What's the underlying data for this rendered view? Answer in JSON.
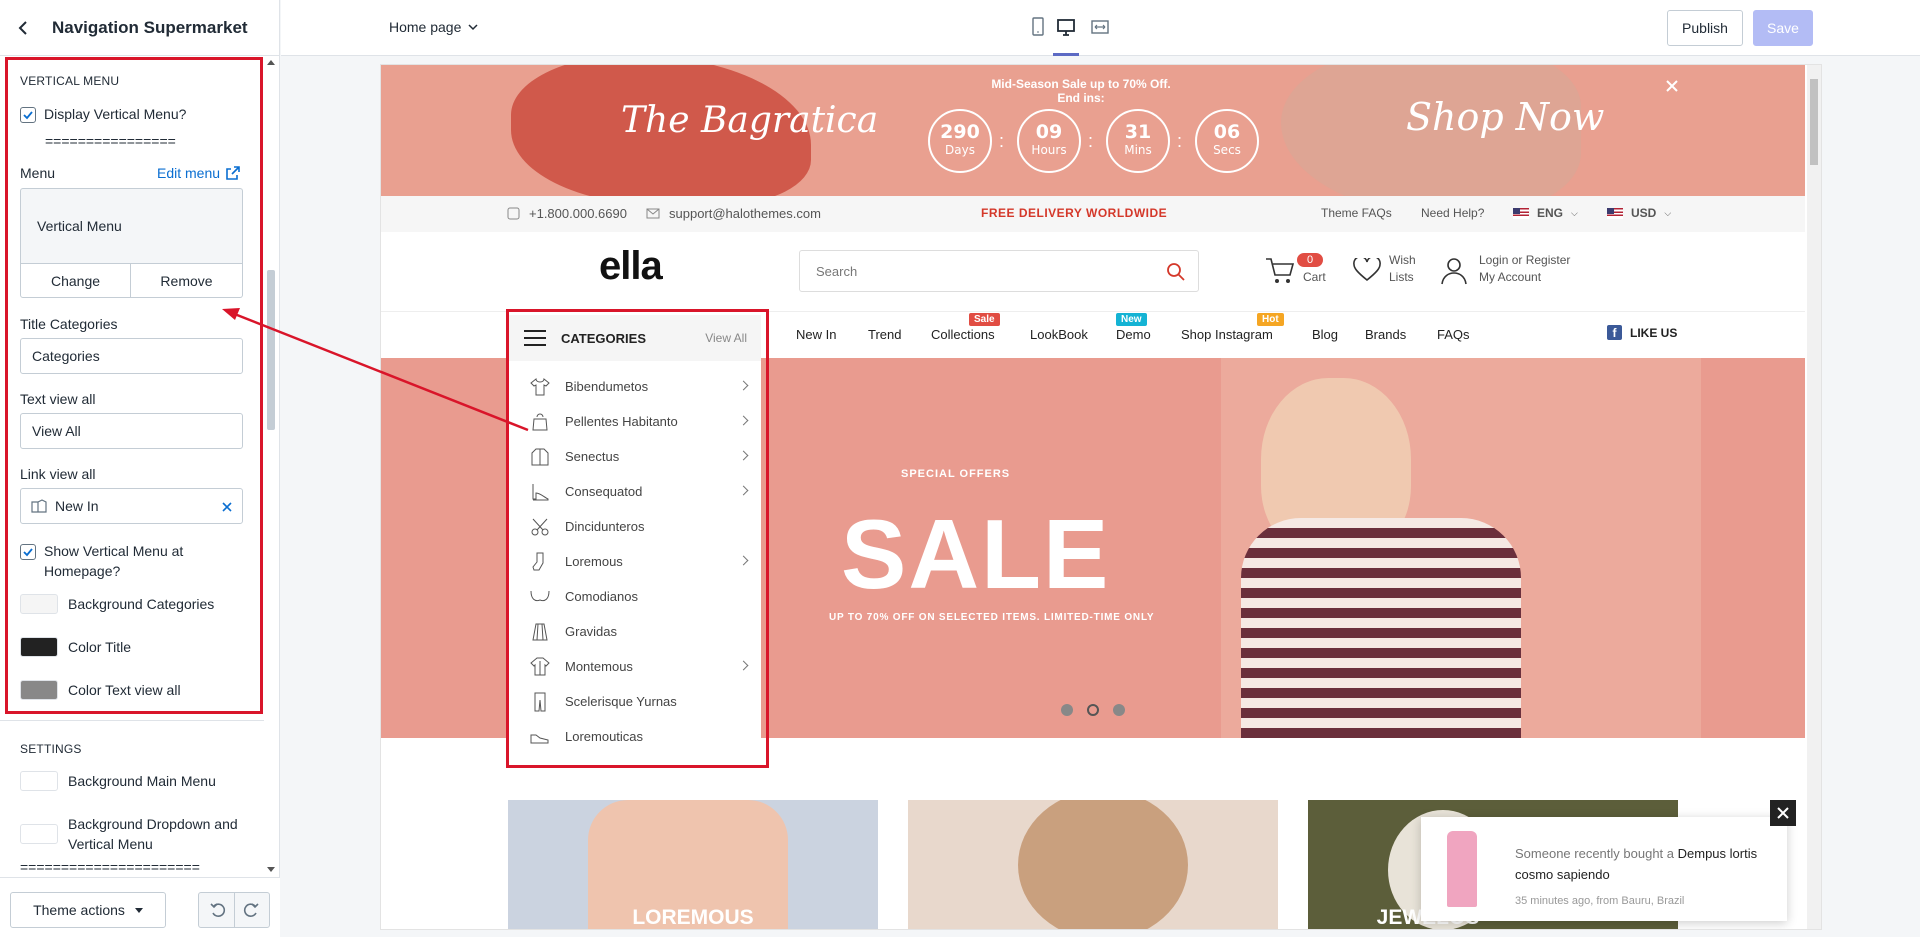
{
  "editor": {
    "title": "Navigation Supermarket",
    "page_select": "Home page",
    "publish_label": "Publish",
    "save_label": "Save",
    "theme_actions_label": "Theme actions"
  },
  "vertical_menu_settings": {
    "section_title": "VERTICAL MENU",
    "display_label": "Display Vertical Menu?",
    "divider": "================",
    "menu_label": "Menu",
    "edit_menu_label": "Edit menu",
    "menu_value": "Vertical Menu",
    "change_label": "Change",
    "remove_label": "Remove",
    "title_categories_label": "Title Categories",
    "title_categories_value": "Categories",
    "text_view_all_label": "Text view all",
    "text_view_all_value": "View All",
    "link_view_all_label": "Link view all",
    "link_view_all_value": "New In",
    "show_homepage_label": "Show Vertical Menu at Homepage?",
    "bg_categories_label": "Background Categories",
    "color_title_label": "Color Title",
    "color_text_view_all_label": "Color Text view all",
    "bg_categories_color": "#f5f5f5",
    "color_title_color": "#222222",
    "color_text_view_all_color": "#888888"
  },
  "settings": {
    "section_title": "SETTINGS",
    "bg_main_menu_label": "Background Main Menu",
    "bg_dropdown_label": "Background Dropdown and Vertical Menu",
    "divider": "======================"
  },
  "store": {
    "promo_text": "Mid-Season Sale up to 70% Off. End ins:",
    "banner_left": "The Bagratica",
    "banner_right": "Shop Now",
    "countdown": [
      {
        "value": "290",
        "unit": "Days"
      },
      {
        "value": "09",
        "unit": "Hours"
      },
      {
        "value": "31",
        "unit": "Mins"
      },
      {
        "value": "06",
        "unit": "Secs"
      }
    ],
    "phone": "+1.800.000.6690",
    "email": "support@halothemes.com",
    "delivery": "FREE DELIVERY WORLDWIDE",
    "theme_faqs": "Theme FAQs",
    "need_help": "Need Help?",
    "lang": "ENG",
    "currency": "USD",
    "logo": "ella",
    "search_placeholder": "Search",
    "cart_count": "0",
    "cart_label": "Cart",
    "wish_label_1": "Wish",
    "wish_label_2": "Lists",
    "login_label": "Login or Register",
    "account_label": "My Account",
    "categories_title": "CATEGORIES",
    "view_all": "View All",
    "nav": [
      "New In",
      "Trend",
      "Collections",
      "LookBook",
      "Demo",
      "Shop Instagram",
      "Blog",
      "Brands",
      "FAQs"
    ],
    "nav_badges": {
      "collections": "Sale",
      "demo": "New",
      "shop_instagram": "Hot"
    },
    "like_us": "LIKE US",
    "categories": [
      {
        "label": "Bibendumetos",
        "icon": "shirt-icon",
        "has_sub": true
      },
      {
        "label": "Pellentes Habitanto",
        "icon": "bag-icon",
        "has_sub": true
      },
      {
        "label": "Senectus",
        "icon": "jacket-icon",
        "has_sub": true
      },
      {
        "label": "Consequatod",
        "icon": "heel-icon",
        "has_sub": true
      },
      {
        "label": "Dincidunteros",
        "icon": "scissors-icon",
        "has_sub": false
      },
      {
        "label": "Loremous",
        "icon": "sock-icon",
        "has_sub": true
      },
      {
        "label": "Comodianos",
        "icon": "bra-icon",
        "has_sub": false
      },
      {
        "label": "Gravidas",
        "icon": "skirt-icon",
        "has_sub": false
      },
      {
        "label": "Montemous",
        "icon": "coat-icon",
        "has_sub": true
      },
      {
        "label": "Scelerisque Yurnas",
        "icon": "pants-icon",
        "has_sub": false
      },
      {
        "label": "Loremouticas",
        "icon": "shoe-icon",
        "has_sub": false
      }
    ],
    "hero_kicker": "SPECIAL OFFERS",
    "hero_title": "SALE",
    "hero_sub": "UP TO 70% OFF ON SELECTED ITEMS. LIMITED-TIME ONLY",
    "product_1": "LOREMOUS",
    "product_3": "JEWELOS",
    "toast_prefix": "Someone recently bought a",
    "toast_product": "Dempus lortis cosmo sapiendo",
    "toast_time": "35 minutes ago,  from Bauru, Brazil"
  }
}
